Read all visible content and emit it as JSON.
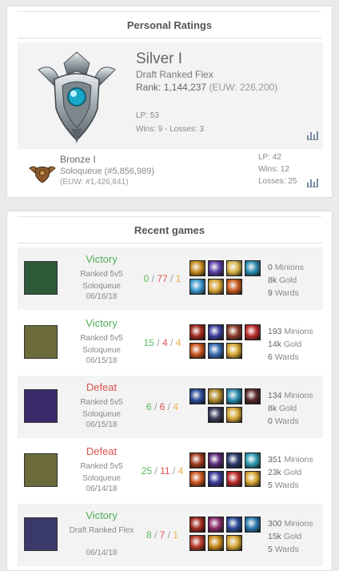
{
  "personal": {
    "heading": "Personal Ratings",
    "main": {
      "tier": "Silver I",
      "queue": "Draft Ranked Flex",
      "rank_label": "Rank:",
      "rank_value": "1,144,237",
      "rank_region": "(EUW: 226,200)",
      "lp": "LP: 53",
      "winslosses": "Wins: 9 - Losses: 3"
    },
    "sub": {
      "tier": "Bronze I",
      "queue": "Soloqueue (#5,856,989)",
      "region": "(EUW: #1,426,841)",
      "lp": "LP: 42",
      "wins": "Wins: 12",
      "losses": "Losses: 25"
    }
  },
  "recent": {
    "heading": "Recent games",
    "games": [
      {
        "result": "Victory",
        "outcome": "win",
        "queue": "Ranked 5v5 Soloqueue",
        "date": "06/16/18",
        "kills": "0",
        "deaths": "77",
        "assists": "1",
        "minions": "0",
        "gold": "8k",
        "wards": "9",
        "minions_label": "Minions",
        "gold_label": "Gold",
        "wards_label": "Wards",
        "champion_color": "#2f5a3a",
        "items": [
          "#c88a1a",
          "#5b3fa8",
          "#d8b44a",
          "#2a8bb0",
          "#3a9ad0",
          "#d7a433",
          "#c95a1e"
        ]
      },
      {
        "result": "Victory",
        "outcome": "win",
        "queue": "Ranked 5v5 Soloqueue",
        "date": "06/15/18",
        "kills": "15",
        "deaths": "4",
        "assists": "4",
        "minions": "193",
        "gold": "14k",
        "wards": "6",
        "minions_label": "Minions",
        "gold_label": "Gold",
        "wards_label": "Wards",
        "champion_color": "#6b6a3a",
        "items": [
          "#a02a1e",
          "#3b3f9a",
          "#8a3a2a",
          "#b82a2a",
          "#c8541e",
          "#3a6bb0",
          "#d7a433"
        ]
      },
      {
        "result": "Defeat",
        "outcome": "loss",
        "queue": "Ranked 5v5 Soloqueue",
        "date": "06/15/18",
        "kills": "6",
        "deaths": "6",
        "assists": "4",
        "minions": "134",
        "gold": "8k",
        "wards": "0",
        "minions_label": "Minions",
        "gold_label": "Gold",
        "wards_label": "Wards",
        "champion_color": "#3a2a6a",
        "items": [
          "#2a4a9a",
          "#b08a2a",
          "#2a8ab0",
          "#5a2a2a",
          "#3a3a5a",
          "#d7a433"
        ]
      },
      {
        "result": "Defeat",
        "outcome": "loss",
        "queue": "Ranked 5v5 Soloqueue",
        "date": "06/14/18",
        "kills": "25",
        "deaths": "11",
        "assists": "4",
        "minions": "351",
        "gold": "23k",
        "wards": "5",
        "minions_label": "Minions",
        "gold_label": "Gold",
        "wards_label": "Wards",
        "champion_color": "#6b6a3a",
        "items": [
          "#a03a1e",
          "#5a2a7a",
          "#2a3a6a",
          "#2a9ab0",
          "#c8541e",
          "#3a3a9a",
          "#b82a2a",
          "#d7a433"
        ]
      },
      {
        "result": "Victory",
        "outcome": "win",
        "queue": "Draft Ranked Flex",
        "date": "06/14/18",
        "kills": "8",
        "deaths": "7",
        "assists": "1",
        "minions": "300",
        "gold": "15k",
        "wards": "5",
        "minions_label": "Minions",
        "gold_label": "Gold",
        "wards_label": "Wards",
        "champion_color": "#3a3a6a",
        "items": [
          "#a02a1e",
          "#8a2a6a",
          "#2a4a9a",
          "#2a7ab0",
          "#b83a2a",
          "#c88a1a",
          "#d7a433"
        ]
      }
    ]
  }
}
